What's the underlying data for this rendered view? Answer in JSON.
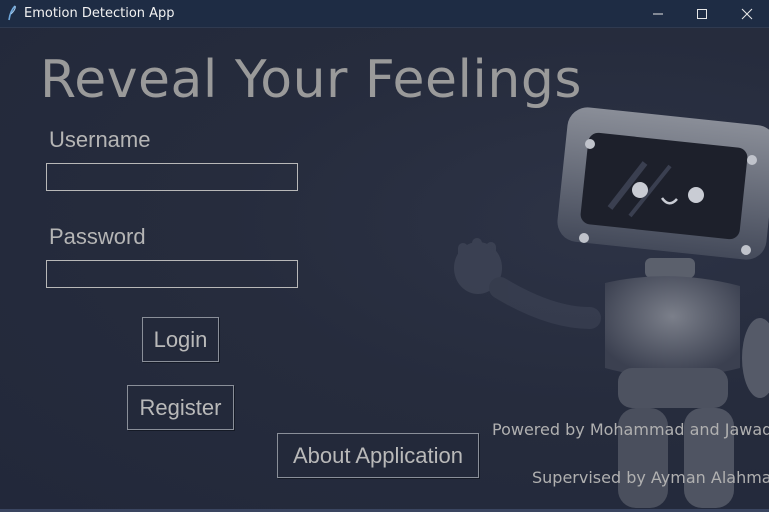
{
  "window": {
    "title": "Emotion Detection App",
    "controls": {
      "minimize": "minimize-icon",
      "maximize": "maximize-icon",
      "close": "close-icon"
    }
  },
  "main": {
    "headline": "Reveal Your Feelings",
    "username_label": "Username",
    "username_value": "",
    "password_label": "Password",
    "password_value": "",
    "login_label": "Login",
    "register_label": "Register",
    "about_label": "About Application",
    "powered_by": "Powered by Mohammad and Jawad",
    "supervised_by": "Supervised by Ayman Alahmad"
  },
  "illustration": {
    "icon": "robot-illustration"
  },
  "colors": {
    "background": "#22283a",
    "titlebar": "#1e2c44",
    "text": "#b5b5b5",
    "headline": "#9a9a9a"
  }
}
